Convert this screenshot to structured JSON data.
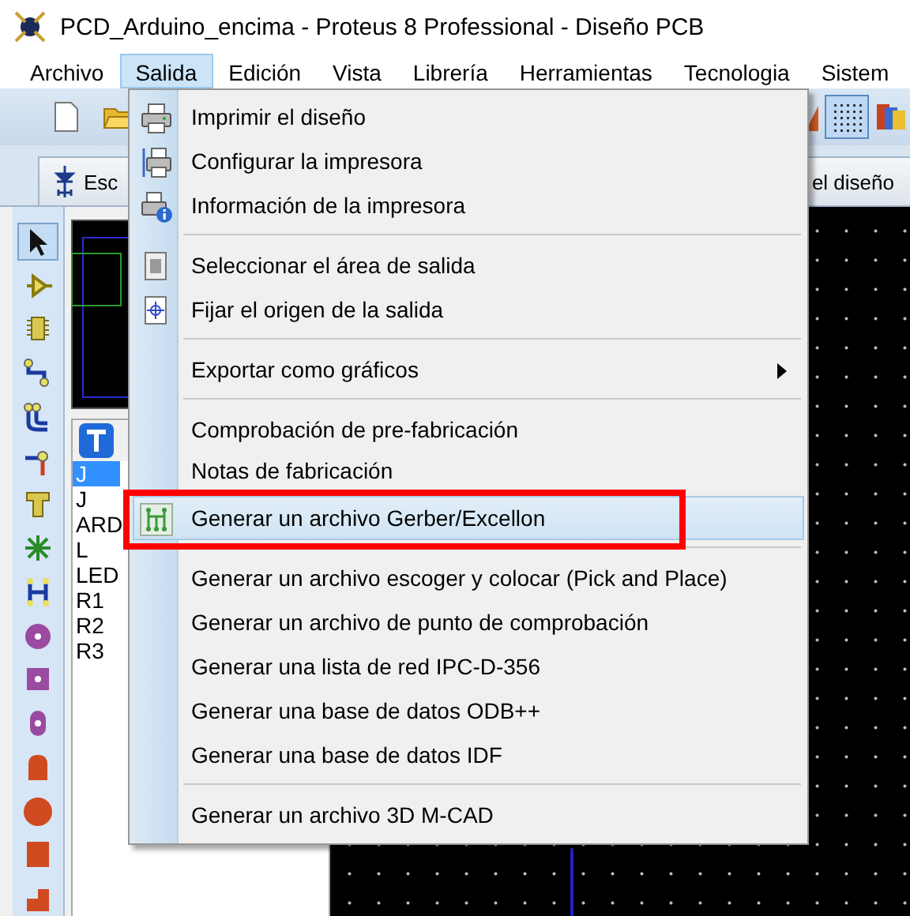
{
  "window": {
    "title": "PCD_Arduino_encima - Proteus 8 Professional - Diseño PCB"
  },
  "menu_bar": [
    {
      "label": "Archivo",
      "selected": false
    },
    {
      "label": "Salida",
      "selected": true
    },
    {
      "label": "Edición",
      "selected": false
    },
    {
      "label": "Vista",
      "selected": false
    },
    {
      "label": "Librería",
      "selected": false
    },
    {
      "label": "Herramientas",
      "selected": false
    },
    {
      "label": "Tecnologia",
      "selected": false
    },
    {
      "label": "Sistem",
      "selected": false
    }
  ],
  "toolbar": {
    "grid_button": {
      "on": true
    }
  },
  "tabs": [
    {
      "label": "Esc"
    },
    {
      "label": "el diseño"
    }
  ],
  "tool_palette": [
    {
      "kind": "pointer",
      "selected": true
    },
    {
      "kind": "component",
      "selected": false
    },
    {
      "kind": "package",
      "selected": false
    },
    {
      "kind": "track",
      "selected": false
    },
    {
      "kind": "via",
      "selected": false
    },
    {
      "kind": "pin",
      "selected": false
    },
    {
      "kind": "text",
      "selected": false
    },
    {
      "kind": "star",
      "selected": false
    },
    {
      "kind": "bus",
      "selected": false
    },
    {
      "kind": "round-pad",
      "selected": false
    },
    {
      "kind": "square-pad",
      "selected": false
    },
    {
      "kind": "oval-pad",
      "selected": false
    },
    {
      "kind": "edge-pad",
      "selected": false
    },
    {
      "kind": "circle",
      "selected": false
    },
    {
      "kind": "square",
      "selected": false
    },
    {
      "kind": "polygon",
      "selected": false
    }
  ],
  "side_panel": {
    "items": [
      {
        "label": "J",
        "selected": true
      },
      {
        "label": "J",
        "selected": false
      },
      {
        "label": "ARD",
        "selected": false
      },
      {
        "label": "L",
        "selected": false
      },
      {
        "label": "LED",
        "selected": false
      },
      {
        "label": "R1",
        "selected": false
      },
      {
        "label": "R2",
        "selected": false
      },
      {
        "label": "R3",
        "selected": false
      }
    ]
  },
  "dropdown": {
    "items": [
      {
        "kind": "item",
        "label": "Imprimir el diseño",
        "highlighted": false,
        "submenu": false
      },
      {
        "kind": "item",
        "label": "Configurar la impresora",
        "highlighted": false,
        "submenu": false
      },
      {
        "kind": "item",
        "label": "Información de la impresora",
        "highlighted": false,
        "submenu": false
      },
      {
        "kind": "separator"
      },
      {
        "kind": "item",
        "label": "Seleccionar el área de salida",
        "highlighted": false,
        "submenu": false
      },
      {
        "kind": "item",
        "label": "Fijar el origen de la salida",
        "highlighted": false,
        "submenu": false
      },
      {
        "kind": "separator"
      },
      {
        "kind": "item",
        "label": "Exportar como gráficos",
        "highlighted": false,
        "submenu": true
      },
      {
        "kind": "separator"
      },
      {
        "kind": "item",
        "label": "Comprobación de pre-fabricación",
        "highlighted": false,
        "submenu": false
      },
      {
        "kind": "item",
        "label": "Notas de fabricación",
        "highlighted": false,
        "submenu": false
      },
      {
        "kind": "item",
        "label": "Generar un archivo Gerber/Excellon",
        "highlighted": true,
        "submenu": false
      },
      {
        "kind": "separator"
      },
      {
        "kind": "item",
        "label": "Generar un archivo escoger y colocar (Pick and Place)",
        "highlighted": false,
        "submenu": false
      },
      {
        "kind": "item",
        "label": "Generar un archivo de punto de comprobación",
        "highlighted": false,
        "submenu": false
      },
      {
        "kind": "item",
        "label": "Generar una lista de red IPC-D-356",
        "highlighted": false,
        "submenu": false
      },
      {
        "kind": "item",
        "label": "Generar una base de datos ODB++",
        "highlighted": false,
        "submenu": false
      },
      {
        "kind": "item",
        "label": "Generar una base de datos IDF",
        "highlighted": false,
        "submenu": false
      },
      {
        "kind": "separator"
      },
      {
        "kind": "item",
        "label": "Generar un archivo 3D M-CAD",
        "highlighted": false,
        "submenu": false
      }
    ]
  }
}
